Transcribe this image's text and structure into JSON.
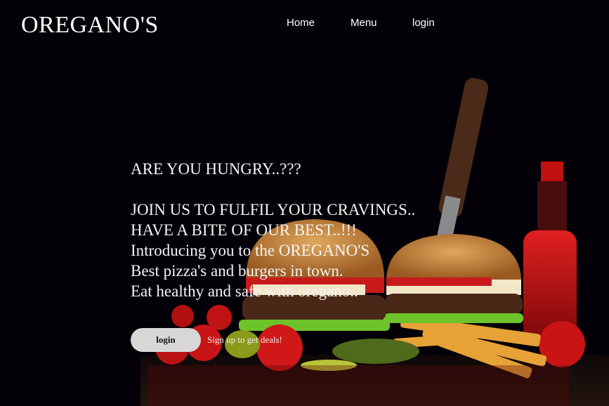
{
  "header": {
    "brand": "OREGANO'S",
    "nav": [
      {
        "label": "Home"
      },
      {
        "label": "Menu"
      },
      {
        "label": "login"
      }
    ]
  },
  "hero": {
    "lines": [
      "ARE YOU HUNGRY..???",
      "JOIN US TO FULFIL YOUR CRAVINGS..",
      "HAVE A BITE OF OUR BEST..!!!",
      "Introducing you to the OREGANO'S",
      "Best pizza's and burgers in town.",
      "Eat healthy and safe with oregano.."
    ]
  },
  "cta": {
    "login_label": "login",
    "signup_label": "Sign up to get deals!"
  },
  "colors": {
    "background": "#030008",
    "text": "#ffffff",
    "button_bg": "#d7d7d7"
  }
}
